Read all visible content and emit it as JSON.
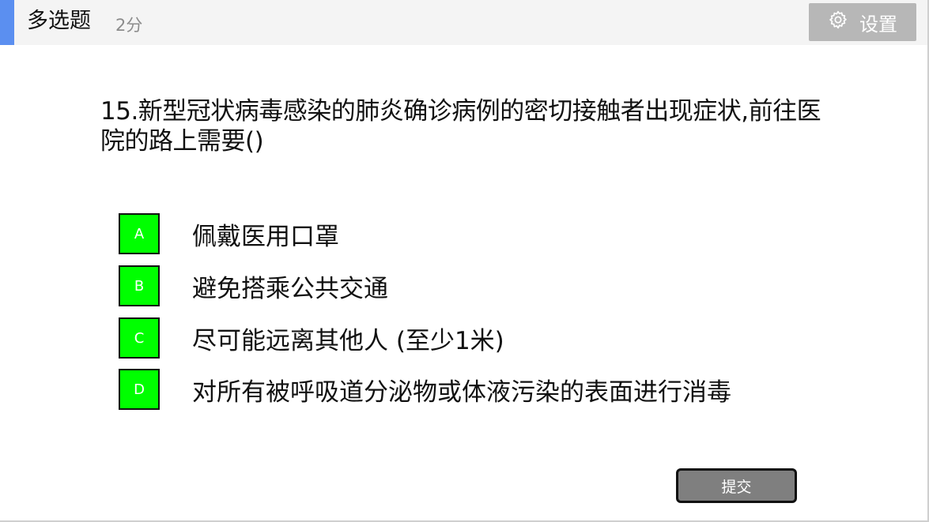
{
  "header": {
    "title": "多选题",
    "score": "2分",
    "settings_label": "设置",
    "settings_icon": "gear-icon",
    "accent_color": "#5b8ff0"
  },
  "question": {
    "text": "15.新型冠状病毒感染的肺炎确诊病例的密切接触者出现症状,前往医院的路上需要()"
  },
  "options": [
    {
      "letter": "A",
      "text": "佩戴医用口罩"
    },
    {
      "letter": "B",
      "text": "避免搭乘公共交通"
    },
    {
      "letter": "C",
      "text": "尽可能远离其他人 (至少1米)"
    },
    {
      "letter": "D",
      "text": "对所有被呼吸道分泌物或体液污染的表面进行消毒"
    }
  ],
  "option_color": "#00ff00",
  "submit": {
    "label": "提交"
  }
}
